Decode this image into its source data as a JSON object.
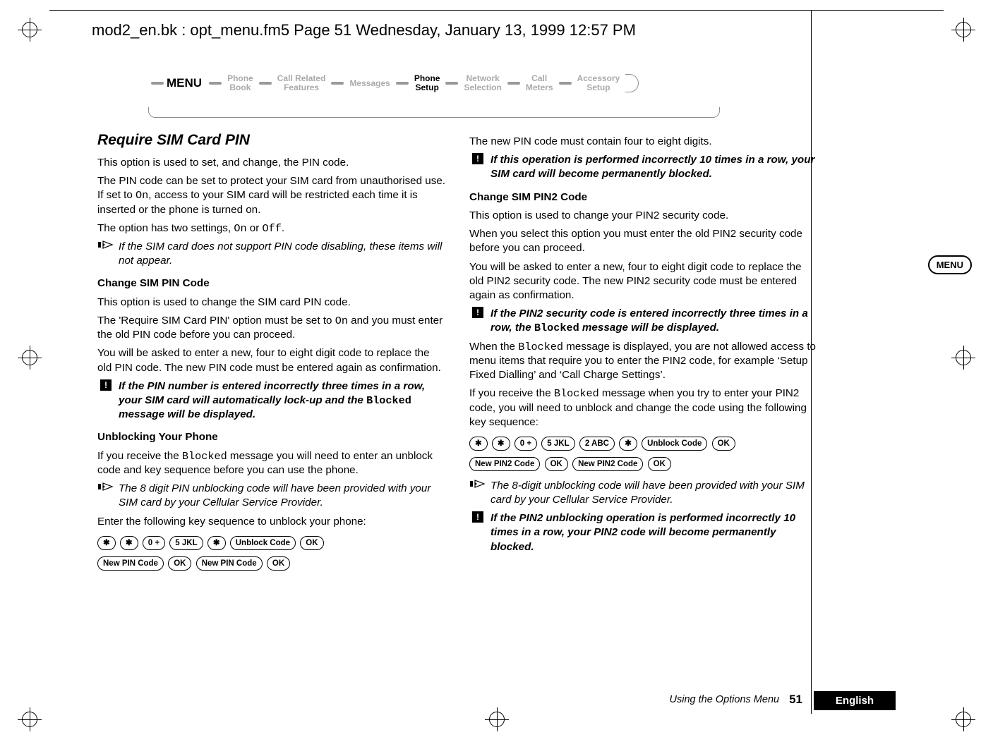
{
  "header": {
    "running_head": "mod2_en.bk : opt_menu.fm5  Page 51  Wednesday, January 13, 1999  12:57 PM"
  },
  "menu_badge": "MENU",
  "breadcrumb": {
    "menu_label": "MENU",
    "items": [
      {
        "l1": "Phone",
        "l2": "Book",
        "active": false
      },
      {
        "l1": "Call Related",
        "l2": "Features",
        "active": false
      },
      {
        "l1": "Messages",
        "l2": "",
        "active": false
      },
      {
        "l1": "Phone",
        "l2": "Setup",
        "active": true
      },
      {
        "l1": "Network",
        "l2": "Selection",
        "active": false
      },
      {
        "l1": "Call",
        "l2": "Meters",
        "active": false
      },
      {
        "l1": "Accessory",
        "l2": "Setup",
        "active": false
      }
    ]
  },
  "left": {
    "h2": "Require SIM Card PIN",
    "p1": "This option is used to set, and change, the PIN code.",
    "p2a": "The PIN code can be set to protect your SIM card from unauthorised use. If set to ",
    "p2_code": "On",
    "p2b": ", access to your SIM card will be restricted each time it is inserted or the phone is turned on.",
    "p3a": "The option has two settings, ",
    "p3_code1": "On",
    "p3_mid": " or ",
    "p3_code2": "Off",
    "p3b": ".",
    "note1": "If the SIM card does not support PIN code disabling, these items will not appear.",
    "h3a": "Change SIM PIN Code",
    "p4": "This option is used to change the SIM card PIN code.",
    "p5a": "The 'Require SIM Card PIN' option must be set to ",
    "p5_code": "On",
    "p5b": " and you must enter the old PIN code before you can proceed.",
    "p6": "You will be asked to enter a new, four to eight digit code to replace the old PIN code. The new PIN code must be entered again as confirmation.",
    "warn1a": "If the PIN number is entered incorrectly three times in a row, your SIM card will automatically lock-up and the ",
    "warn1_code": "Blocked",
    "warn1b": " message will be displayed.",
    "h3b": "Unblocking Your Phone",
    "p7a": "If you receive the ",
    "p7_code": "Blocked",
    "p7b": " message you will need to enter an unblock code and key sequence before you can use the phone.",
    "note2": "The 8 digit PIN unblocking code will have been provided with your SIM card by your Cellular Service Provider.",
    "p8": "Enter the following key sequence to unblock your phone:",
    "keys": {
      "star": "✱",
      "zero": "0 +",
      "five": "5 JKL",
      "unblock": "Unblock Code",
      "ok": "OK",
      "newpin": "New PIN Code"
    }
  },
  "right": {
    "p1": "The new PIN code must contain four to eight digits.",
    "warn1": "If this operation is performed incorrectly 10 times in a row, your SIM card will become permanently blocked.",
    "h3a": "Change SIM PIN2 Code",
    "p2": "This option is used to change your PIN2 security code.",
    "p3": "When you select this option you must enter the old PIN2 security code before you can proceed.",
    "p4": "You will be asked to enter a new, four to eight digit code to replace the old PIN2 security code. The new PIN2 security code must be entered again as confirmation.",
    "warn2a": "If the PIN2 security code is entered incorrectly three times in a row, the ",
    "warn2_code": "Blocked",
    "warn2b": " message will be displayed.",
    "p5a": "When the ",
    "p5_code": "Blocked",
    "p5b": " message is displayed, you are not allowed access to menu items that require you to enter the PIN2 code, for example ‘Setup Fixed Dialling’ and ‘Call Charge Settings’.",
    "p6a": "If you receive the ",
    "p6_code": "Blocked",
    "p6b": " message when you try to enter your PIN2 code, you will need to unblock and change the code using the following key sequence:",
    "keys": {
      "star": "✱",
      "zero": "0 +",
      "five": "5 JKL",
      "two": "2 ABC",
      "unblock": "Unblock Code",
      "ok": "OK",
      "newpin2": "New PIN2 Code"
    },
    "note1": "The 8-digit unblocking code will have been provided with your SIM card by your Cellular Service Provider.",
    "warn3": "If the PIN2 unblocking operation is performed incorrectly 10 times in a row, your PIN2 code will become permanently blocked."
  },
  "footer": {
    "section": "Using the Options Menu",
    "page": "51",
    "language": "English"
  }
}
